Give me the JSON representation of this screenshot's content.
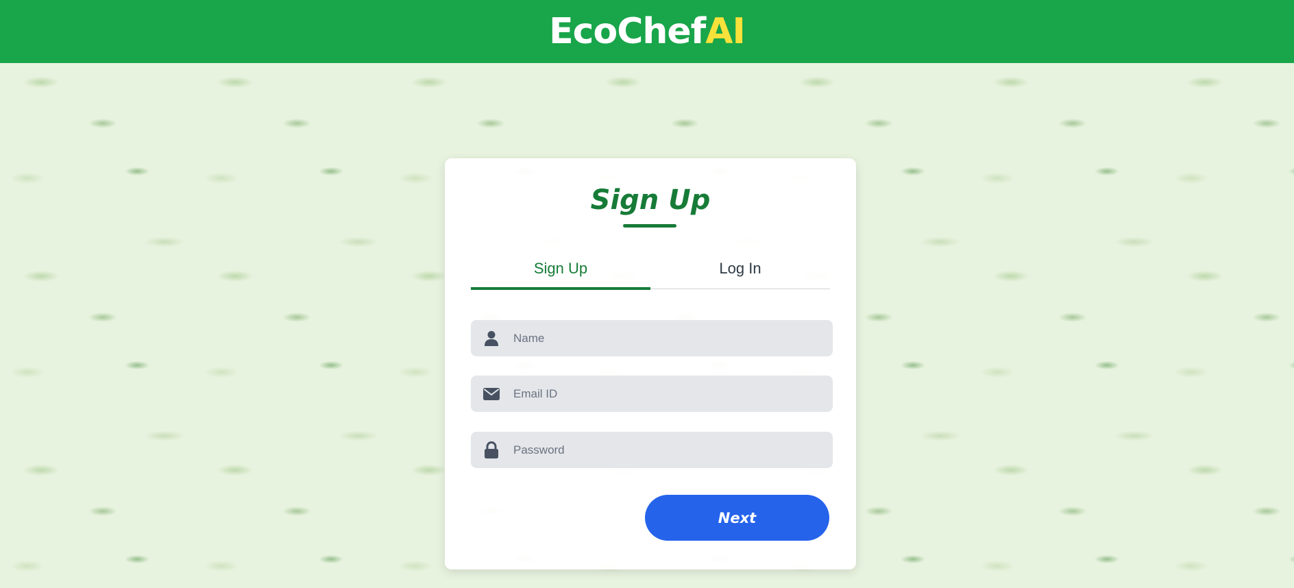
{
  "header": {
    "brand_main": "EcoChef",
    "brand_accent": "AI"
  },
  "signup": {
    "title": "Sign Up",
    "tabs": [
      {
        "label": "Sign Up",
        "active": true
      },
      {
        "label": "Log In",
        "active": false
      }
    ],
    "fields": {
      "name": {
        "placeholder": "Name",
        "value": "",
        "icon": "user-icon"
      },
      "email": {
        "placeholder": "Email ID",
        "value": "",
        "icon": "envelope-icon"
      },
      "password": {
        "placeholder": "Password",
        "value": "",
        "icon": "lock-icon"
      }
    },
    "next_label": "Next"
  },
  "colors": {
    "header_bg": "#19a54a",
    "brand_accent": "#f7e13a",
    "primary_green": "#177b38",
    "button_blue": "#2563eb",
    "field_bg": "#e4e6ea"
  }
}
